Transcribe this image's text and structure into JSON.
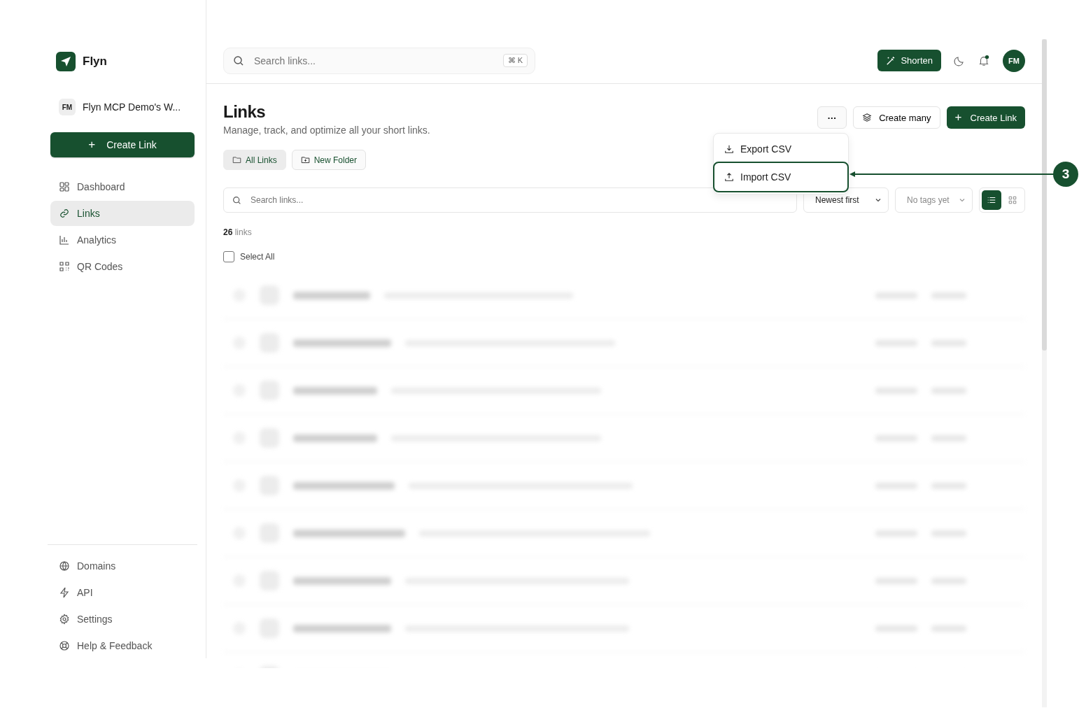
{
  "sidebar": {
    "brand": "Flyn",
    "workspace": {
      "initials": "FM",
      "name": "Flyn MCP Demo's W..."
    },
    "create_button": {
      "icon": "+",
      "label": "Create Link"
    },
    "nav": [
      {
        "label": "Dashboard",
        "selected": false
      },
      {
        "label": "Links",
        "selected": true
      },
      {
        "label": "Analytics",
        "selected": false
      },
      {
        "label": "QR Codes",
        "selected": false
      }
    ],
    "footer_nav": [
      {
        "label": "Domains",
        "selected": false
      },
      {
        "label": "API",
        "selected": false
      },
      {
        "label": "Settings",
        "selected": false
      },
      {
        "label": "Help & Feedback",
        "selected": false
      }
    ]
  },
  "topbar": {
    "search": {
      "placeholder": "Search links...",
      "shortcut": "⌘ K"
    },
    "shorten_button": "Shorten",
    "avatar": "FM",
    "notification_dot": true
  },
  "page": {
    "title": "Links",
    "subtitle": "Manage, track, and optimize all your short links.",
    "actions": {
      "more": "···",
      "create_many": "Create many",
      "create_link_icon": "+",
      "create_link": "Create Link"
    },
    "menu": [
      {
        "label": "Export CSV",
        "highlighted": false
      },
      {
        "label": "Import CSV",
        "highlighted": true
      }
    ],
    "folders": [
      {
        "label": "All Links",
        "kind": "folder",
        "selected": true
      },
      {
        "label": "New Folder",
        "kind": "new",
        "selected": false
      }
    ],
    "filter": {
      "placeholder": "Search links...",
      "sort": "Newest first",
      "tags": "No tags yet",
      "views": [
        {
          "kind": "list",
          "selected": true
        },
        {
          "kind": "grid",
          "selected": false
        }
      ]
    },
    "count": {
      "number": "26",
      "unit": "links"
    },
    "select_all": {
      "label": "Select All",
      "checked": false
    },
    "rows": [
      {
        "kind": "blurred"
      },
      {
        "kind": "blurred"
      },
      {
        "kind": "blurred"
      },
      {
        "kind": "blurred"
      },
      {
        "kind": "blurred"
      },
      {
        "kind": "blurred"
      },
      {
        "kind": "blurred"
      },
      {
        "kind": "blurred"
      },
      {
        "kind": "blurred"
      }
    ]
  },
  "callout": {
    "number": "3"
  }
}
